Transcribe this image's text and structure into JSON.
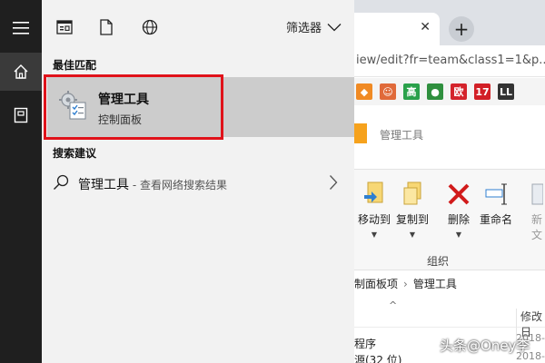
{
  "rail": {
    "items": [
      {
        "icon": "hamburger-menu-icon"
      },
      {
        "icon": "home-icon",
        "active": true
      },
      {
        "icon": "notebook-icon"
      }
    ]
  },
  "search_panel": {
    "toolbar": {
      "icons": [
        "apps-icon",
        "document-icon",
        "web-globe-icon"
      ],
      "filter_label": "筛选器"
    },
    "best_match": {
      "section_label": "最佳匹配",
      "title": "管理工具",
      "subtitle": "控制面板",
      "icon": "admin-tools-icon"
    },
    "suggestions": {
      "section_label": "搜索建议",
      "items": [
        {
          "text": "管理工具",
          "tail": " - 查看网络搜索结果"
        }
      ]
    },
    "highlight_color": "#e0121a"
  },
  "browser": {
    "new_tab_label": "+",
    "url": "iew/edit?fr=team&class1=1&p..",
    "bookmarks": [
      {
        "label": "◆",
        "color": "#f08a24"
      },
      {
        "label": "☺",
        "color": "#e06a3a"
      },
      {
        "label": "高",
        "color": "#2aa14b"
      },
      {
        "label": "●",
        "color": "#2f8f3e"
      },
      {
        "label": "欧",
        "color": "#d4232b"
      },
      {
        "label": "17",
        "color": "#d21f26"
      },
      {
        "label": "LL",
        "color": "#333333"
      }
    ]
  },
  "explorer": {
    "title": "管理工具",
    "ribbon": {
      "move_to": "移动到",
      "copy_to": "复制到",
      "delete": "删除",
      "rename": "重命名",
      "new": "新",
      "new_sub": "文",
      "group_label": "组织"
    },
    "breadcrumb": [
      "制面板项",
      "管理工具"
    ],
    "columns": {
      "modified": "修改日"
    },
    "rows": [
      {
        "name": "程序",
        "date": "2018-"
      },
      {
        "name": "源(32 位)",
        "date": "2018-"
      }
    ]
  },
  "watermark": "头条@Oney李"
}
